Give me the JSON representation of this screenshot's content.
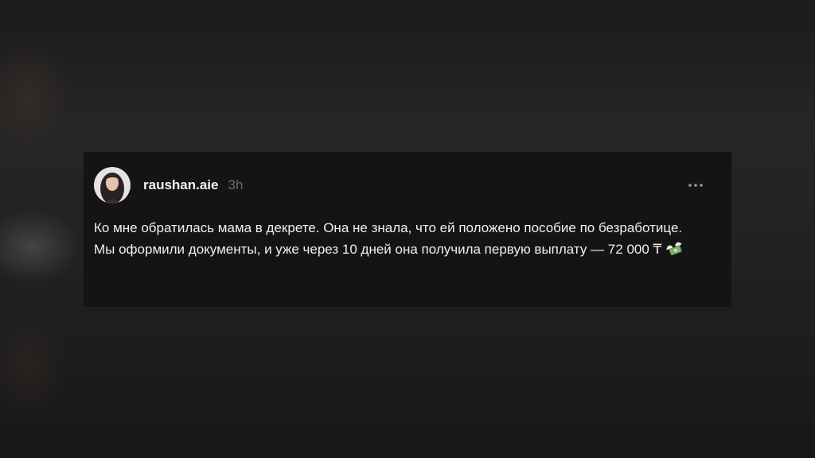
{
  "post": {
    "username": "raushan.aie",
    "timestamp": "3h",
    "more_icon": "more-horizontal-icon",
    "avatar_icon": "user-avatar",
    "paragraph1": "Ко мне обратилась мама в декрете. Она не знала, что ей положено пособие по безработице.",
    "paragraph2": "Мы оформили документы, и уже через 10 дней она получила первую выплату — 72 000 ₸",
    "emoji": "money-with-wings-icon"
  }
}
